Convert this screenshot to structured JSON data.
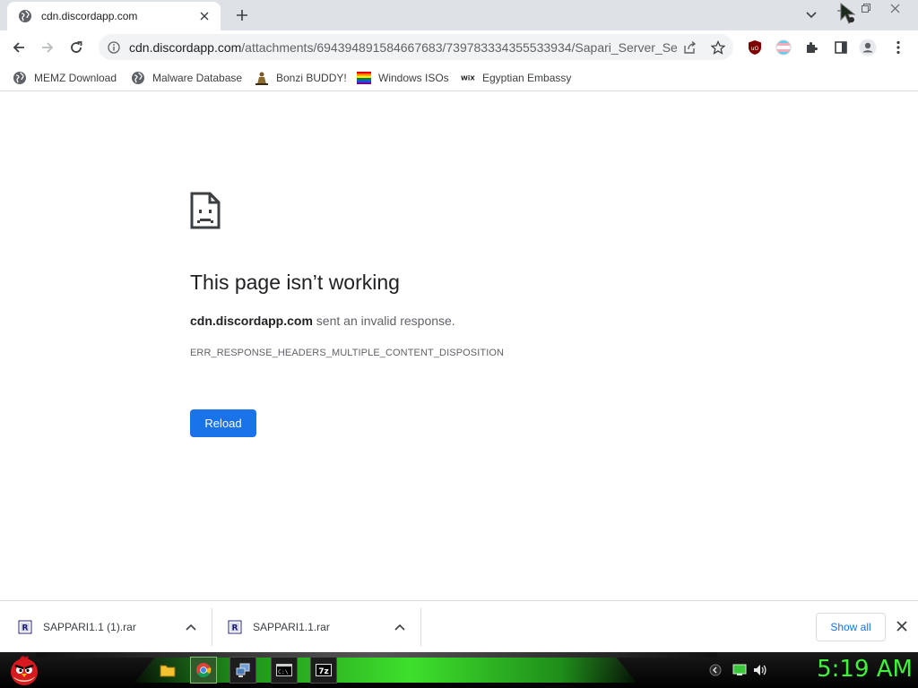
{
  "tab": {
    "title": "cdn.discordapp.com",
    "favicon": "globe-icon"
  },
  "address_bar": {
    "url_host": "cdn.discordapp.com",
    "url_path": "/attachments/694394891584667683/739783334355533934/Sapari_Server_Se..."
  },
  "bookmarks": [
    {
      "label": "MEMZ Download",
      "icon": "globe-icon"
    },
    {
      "label": "Malware Database",
      "icon": "globe-icon"
    },
    {
      "label": "Bonzi BUDDY!",
      "icon": "bonzi-icon"
    },
    {
      "label": "Windows ISOs",
      "icon": "rainbow-flag-icon"
    },
    {
      "label": "Egyptian Embassy",
      "icon": "wix-icon"
    }
  ],
  "error_page": {
    "title": "This page isn’t working",
    "host": "cdn.discordapp.com",
    "desc_suffix": " sent an invalid response.",
    "code": "ERR_RESPONSE_HEADERS_MULTIPLE_CONTENT_DISPOSITION",
    "reload_label": "Reload"
  },
  "downloads": [
    {
      "name": "SAPPARI1.1 (1).rar"
    },
    {
      "name": "SAPPARI1.1.rar"
    }
  ],
  "download_shelf": {
    "show_all_label": "Show all"
  },
  "taskbar": {
    "clock": "5:19 AM"
  },
  "colors": {
    "accent": "#1a73e8",
    "tabstrip": "#dee1e6",
    "clock_green": "#3ff23a",
    "taskbar_glow": "#3ee02c"
  }
}
